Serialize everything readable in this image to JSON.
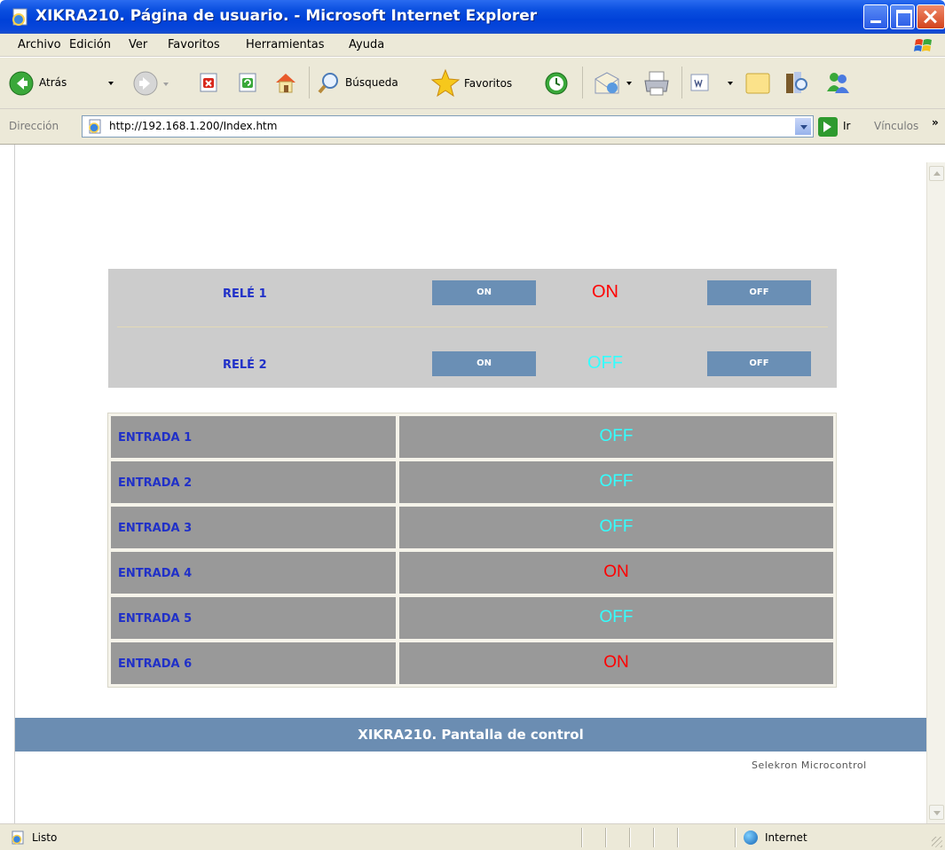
{
  "window": {
    "title": "XIKRA210. Página de usuario. - Microsoft Internet Explorer"
  },
  "menu": {
    "archivo": "Archivo",
    "edicion": "Edición",
    "ver": "Ver",
    "favoritos": "Favoritos",
    "herramientas": "Herramientas",
    "ayuda": "Ayuda"
  },
  "toolbar": {
    "back": "Atrás",
    "search": "Búsqueda",
    "favorites": "Favoritos"
  },
  "address": {
    "label": "Dirección",
    "url": "http://192.168.1.200/Index.htm",
    "go": "Ir",
    "links": "Vínculos",
    "links_chevron": "»"
  },
  "relays": [
    {
      "label": "RELÉ 1",
      "on_button": "ON",
      "state": "ON",
      "state_color": "#ff0000",
      "off_button": "OFF"
    },
    {
      "label": "RELÉ 2",
      "on_button": "ON",
      "state": "OFF",
      "state_color": "#33ffff",
      "off_button": "OFF"
    }
  ],
  "inputs": [
    {
      "label": "ENTRADA 1",
      "state": "OFF",
      "state_color": "#33ffff"
    },
    {
      "label": "ENTRADA 2",
      "state": "OFF",
      "state_color": "#33ffff"
    },
    {
      "label": "ENTRADA 3",
      "state": "OFF",
      "state_color": "#33ffff"
    },
    {
      "label": "ENTRADA 4",
      "state": "ON",
      "state_color": "#ff0000"
    },
    {
      "label": "ENTRADA 5",
      "state": "OFF",
      "state_color": "#33ffff"
    },
    {
      "label": "ENTRADA 6",
      "state": "ON",
      "state_color": "#ff0000"
    }
  ],
  "footer": {
    "title": "XIKRA210. Pantalla de control",
    "credit": "Selekron Microcontrol"
  },
  "statusbar": {
    "text": "Listo",
    "zone": "Internet"
  },
  "colors": {
    "accent_blue": "#2030c8",
    "button_blue": "#6a8fb5",
    "footer_blue": "#6b8db2",
    "panel_gray": "#cccccc",
    "cell_gray": "#999999"
  }
}
